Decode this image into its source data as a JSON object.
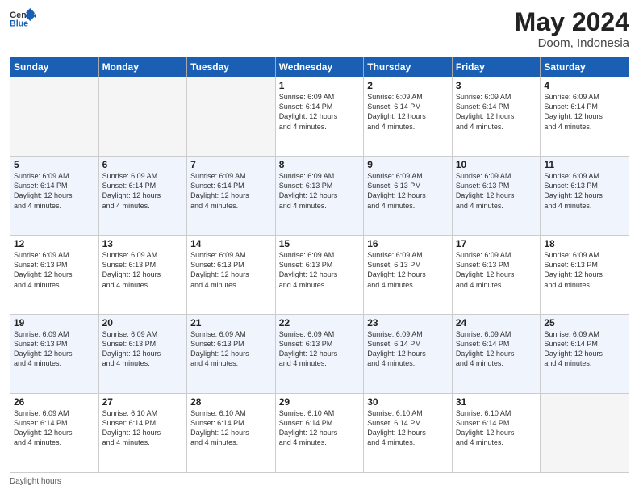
{
  "header": {
    "logo_line1": "General",
    "logo_line2": "Blue",
    "month": "May 2024",
    "location": "Doom, Indonesia"
  },
  "days_of_week": [
    "Sunday",
    "Monday",
    "Tuesday",
    "Wednesday",
    "Thursday",
    "Friday",
    "Saturday"
  ],
  "weeks": [
    [
      {
        "day": "",
        "info": ""
      },
      {
        "day": "",
        "info": ""
      },
      {
        "day": "",
        "info": ""
      },
      {
        "day": "1",
        "info": "Sunrise: 6:09 AM\nSunset: 6:14 PM\nDaylight: 12 hours\nand 4 minutes."
      },
      {
        "day": "2",
        "info": "Sunrise: 6:09 AM\nSunset: 6:14 PM\nDaylight: 12 hours\nand 4 minutes."
      },
      {
        "day": "3",
        "info": "Sunrise: 6:09 AM\nSunset: 6:14 PM\nDaylight: 12 hours\nand 4 minutes."
      },
      {
        "day": "4",
        "info": "Sunrise: 6:09 AM\nSunset: 6:14 PM\nDaylight: 12 hours\nand 4 minutes."
      }
    ],
    [
      {
        "day": "5",
        "info": "Sunrise: 6:09 AM\nSunset: 6:14 PM\nDaylight: 12 hours\nand 4 minutes."
      },
      {
        "day": "6",
        "info": "Sunrise: 6:09 AM\nSunset: 6:14 PM\nDaylight: 12 hours\nand 4 minutes."
      },
      {
        "day": "7",
        "info": "Sunrise: 6:09 AM\nSunset: 6:14 PM\nDaylight: 12 hours\nand 4 minutes."
      },
      {
        "day": "8",
        "info": "Sunrise: 6:09 AM\nSunset: 6:13 PM\nDaylight: 12 hours\nand 4 minutes."
      },
      {
        "day": "9",
        "info": "Sunrise: 6:09 AM\nSunset: 6:13 PM\nDaylight: 12 hours\nand 4 minutes."
      },
      {
        "day": "10",
        "info": "Sunrise: 6:09 AM\nSunset: 6:13 PM\nDaylight: 12 hours\nand 4 minutes."
      },
      {
        "day": "11",
        "info": "Sunrise: 6:09 AM\nSunset: 6:13 PM\nDaylight: 12 hours\nand 4 minutes."
      }
    ],
    [
      {
        "day": "12",
        "info": "Sunrise: 6:09 AM\nSunset: 6:13 PM\nDaylight: 12 hours\nand 4 minutes."
      },
      {
        "day": "13",
        "info": "Sunrise: 6:09 AM\nSunset: 6:13 PM\nDaylight: 12 hours\nand 4 minutes."
      },
      {
        "day": "14",
        "info": "Sunrise: 6:09 AM\nSunset: 6:13 PM\nDaylight: 12 hours\nand 4 minutes."
      },
      {
        "day": "15",
        "info": "Sunrise: 6:09 AM\nSunset: 6:13 PM\nDaylight: 12 hours\nand 4 minutes."
      },
      {
        "day": "16",
        "info": "Sunrise: 6:09 AM\nSunset: 6:13 PM\nDaylight: 12 hours\nand 4 minutes."
      },
      {
        "day": "17",
        "info": "Sunrise: 6:09 AM\nSunset: 6:13 PM\nDaylight: 12 hours\nand 4 minutes."
      },
      {
        "day": "18",
        "info": "Sunrise: 6:09 AM\nSunset: 6:13 PM\nDaylight: 12 hours\nand 4 minutes."
      }
    ],
    [
      {
        "day": "19",
        "info": "Sunrise: 6:09 AM\nSunset: 6:13 PM\nDaylight: 12 hours\nand 4 minutes."
      },
      {
        "day": "20",
        "info": "Sunrise: 6:09 AM\nSunset: 6:13 PM\nDaylight: 12 hours\nand 4 minutes."
      },
      {
        "day": "21",
        "info": "Sunrise: 6:09 AM\nSunset: 6:13 PM\nDaylight: 12 hours\nand 4 minutes."
      },
      {
        "day": "22",
        "info": "Sunrise: 6:09 AM\nSunset: 6:13 PM\nDaylight: 12 hours\nand 4 minutes."
      },
      {
        "day": "23",
        "info": "Sunrise: 6:09 AM\nSunset: 6:14 PM\nDaylight: 12 hours\nand 4 minutes."
      },
      {
        "day": "24",
        "info": "Sunrise: 6:09 AM\nSunset: 6:14 PM\nDaylight: 12 hours\nand 4 minutes."
      },
      {
        "day": "25",
        "info": "Sunrise: 6:09 AM\nSunset: 6:14 PM\nDaylight: 12 hours\nand 4 minutes."
      }
    ],
    [
      {
        "day": "26",
        "info": "Sunrise: 6:09 AM\nSunset: 6:14 PM\nDaylight: 12 hours\nand 4 minutes."
      },
      {
        "day": "27",
        "info": "Sunrise: 6:10 AM\nSunset: 6:14 PM\nDaylight: 12 hours\nand 4 minutes."
      },
      {
        "day": "28",
        "info": "Sunrise: 6:10 AM\nSunset: 6:14 PM\nDaylight: 12 hours\nand 4 minutes."
      },
      {
        "day": "29",
        "info": "Sunrise: 6:10 AM\nSunset: 6:14 PM\nDaylight: 12 hours\nand 4 minutes."
      },
      {
        "day": "30",
        "info": "Sunrise: 6:10 AM\nSunset: 6:14 PM\nDaylight: 12 hours\nand 4 minutes."
      },
      {
        "day": "31",
        "info": "Sunrise: 6:10 AM\nSunset: 6:14 PM\nDaylight: 12 hours\nand 4 minutes."
      },
      {
        "day": "",
        "info": ""
      }
    ]
  ],
  "footer": {
    "note": "Daylight hours"
  }
}
